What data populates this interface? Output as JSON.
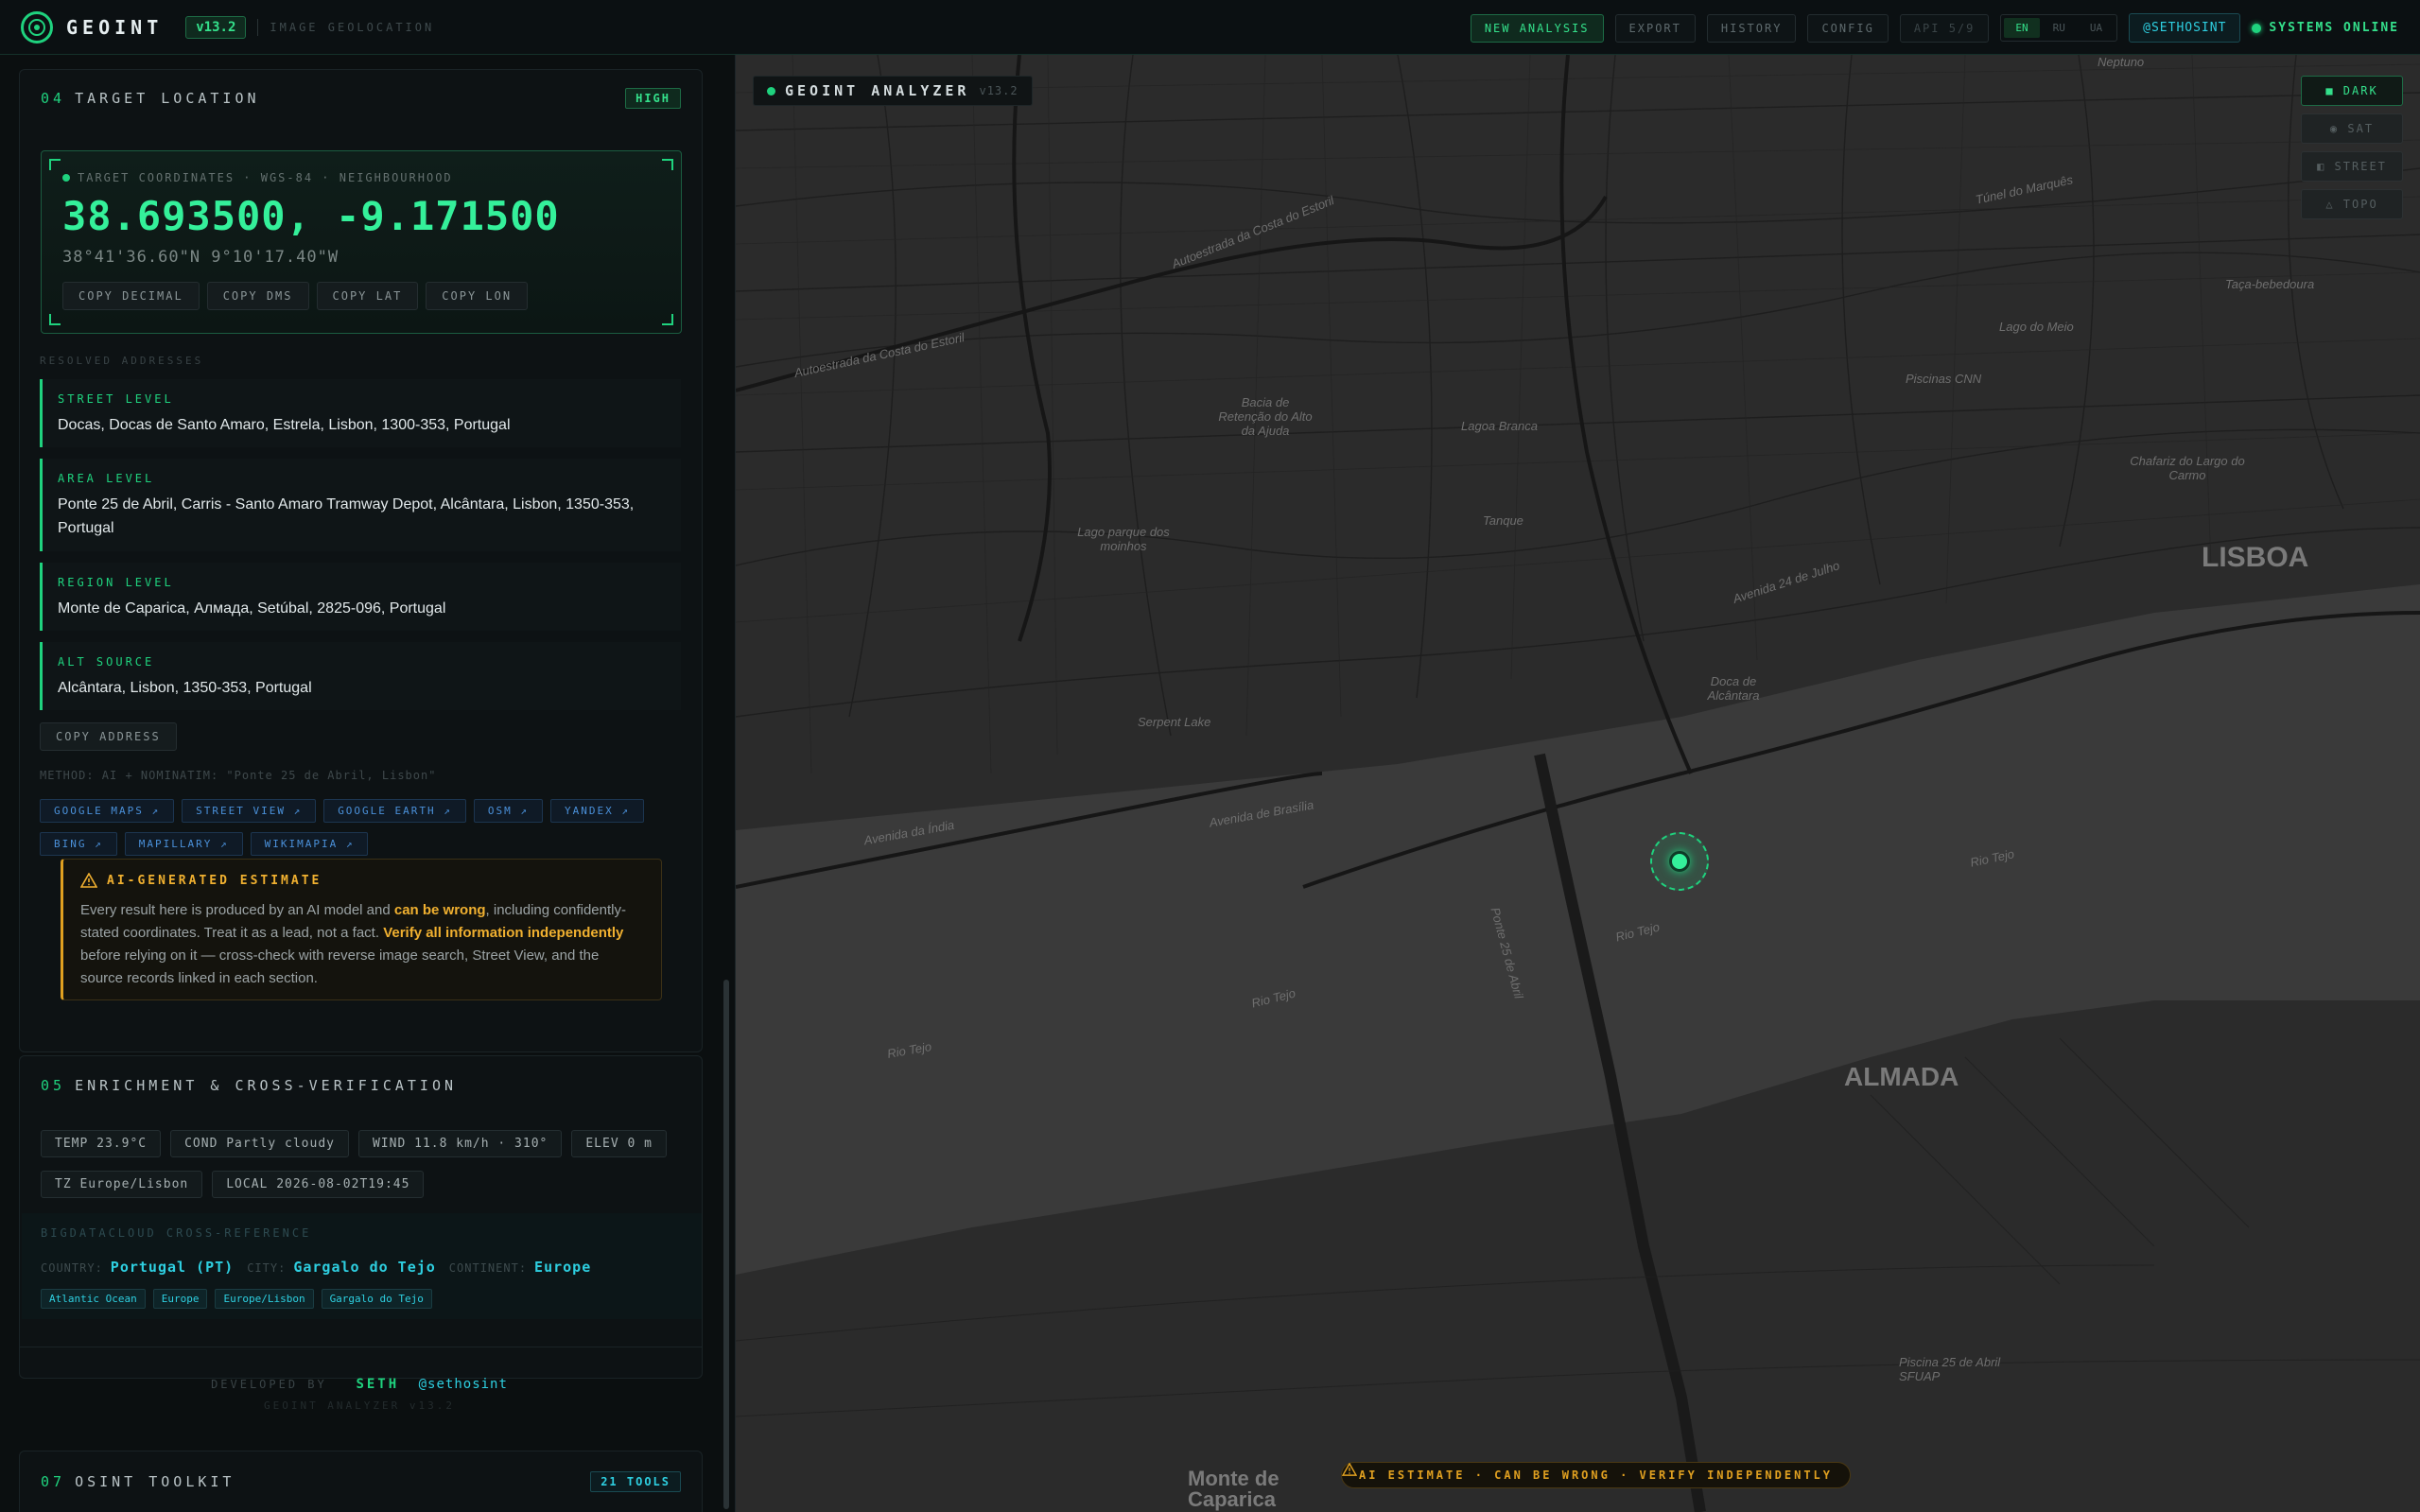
{
  "header": {
    "brand": "GEOINT",
    "version": "v13.2",
    "subtitle": "IMAGE GEOLOCATION",
    "buttons": [
      "NEW ANALYSIS",
      "EXPORT",
      "HISTORY",
      "CONFIG"
    ],
    "api": "API 5/9",
    "languages": [
      "EN",
      "RU",
      "UA"
    ],
    "handle": "@SETHOSINT",
    "status": "SYSTEMS ONLINE"
  },
  "target": {
    "num": "04",
    "title": "TARGET LOCATION",
    "confidence": "HIGH",
    "coord_label": "TARGET COORDINATES · WGS-84 · NEIGHBOURHOOD",
    "coord_decimal": "38.693500, -9.171500",
    "coord_dms": "38°41'36.60\"N 9°10'17.40\"W",
    "copy_buttons": [
      "COPY DECIMAL",
      "COPY DMS",
      "COPY LAT",
      "COPY LON"
    ],
    "resolved_label": "RESOLVED ADDRESSES",
    "addresses": [
      {
        "level": "STREET LEVEL",
        "text": "Docas, Docas de Santo Amaro, Estrela, Lisbon, 1300-353, Portugal"
      },
      {
        "level": "AREA LEVEL",
        "text": "Ponte 25 de Abril, Carris - Santo Amaro Tramway Depot, Alcântara, Lisbon, 1350-353, Portugal"
      },
      {
        "level": "REGION LEVEL",
        "text": "Monte de Caparica, Алмада, Setúbal, 2825-096, Portugal"
      },
      {
        "level": "ALT SOURCE",
        "text": "Alcântara, Lisbon, 1350-353, Portugal"
      }
    ],
    "copy_address": "COPY ADDRESS",
    "method": "METHOD: AI + NOMINATIM: \"Ponte 25 de Abril, Lisbon\"",
    "links": [
      "GOOGLE MAPS ↗",
      "STREET VIEW ↗",
      "GOOGLE EARTH ↗",
      "OSM ↗",
      "YANDEX ↗",
      "BING ↗",
      "MAPILLARY ↗",
      "WIKIMAPIA ↗"
    ],
    "warning": {
      "title": "AI-GENERATED ESTIMATE",
      "t1": "Every result here is produced by an AI model and ",
      "b1": "can be wrong",
      "t2": ", including confidently-stated coordinates. Treat it as a lead, not a fact. ",
      "b2": "Verify all information independently",
      "t3": " before relying on it — cross-check with reverse image search, Street View, and the source records linked in each section."
    }
  },
  "enrichment": {
    "num": "05",
    "title": "ENRICHMENT & CROSS-VERIFICATION",
    "chips_row1": [
      "TEMP 23.9°C",
      "COND Partly cloudy",
      "WIND 11.8 km/h · 310°",
      "ELEV 0 m"
    ],
    "chips_row2": [
      "TZ Europe/Lisbon",
      "LOCAL 2026-08-02T19:45"
    ],
    "bdc_label": "BIGDATACLOUD CROSS-REFERENCE",
    "country_key": "COUNTRY:",
    "country": "Portugal (PT)",
    "city_key": "CITY:",
    "city": "Gargalo do Tejo",
    "continent_key": "CONTINENT:",
    "continent": "Europe",
    "tags": [
      "Atlantic Ocean",
      "Europe",
      "Europe/Lisbon",
      "Gargalo do Tejo"
    ]
  },
  "footer": {
    "developed_by": "DEVELOPED BY",
    "dev_name": "SETH",
    "dev_handle": "@sethosint",
    "app_version": "GEOINT ANALYZER v13.2"
  },
  "toolkit": {
    "num": "07",
    "title": "OSINT TOOLKIT",
    "count": "21 TOOLS"
  },
  "map": {
    "title": "GEOINT ANALYZER",
    "version": "v13.2",
    "layers": [
      "DARK",
      "SAT",
      "STREET",
      "TOPO"
    ],
    "warning": "AI ESTIMATE · CAN BE WRONG · VERIFY INDEPENDENTLY",
    "labels": {
      "lisboa": "LISBOA",
      "almada": "ALMADA",
      "monte": "Monte de Caparica",
      "rio1": "Rio Tejo",
      "rio2": "Rio Tejo",
      "rio3": "Rio Tejo",
      "rio4": "Rio Tejo",
      "lagoa_branca": "Lagoa Branca",
      "tanque": "Tanque",
      "bacia": "Bacia de Retenção do Alto da Ajuda",
      "lago_parque": "Lago parque dos moinhos",
      "serpent": "Serpent Lake",
      "piscinas": "Piscinas CNN",
      "lago_meio": "Lago do Meio",
      "chafariz": "Chafariz do Largo do Carmo",
      "doca": "Doca de Alcântara",
      "av_india": "Avenida da Índia",
      "av_brasilia": "Avenida de Brasília",
      "av_24": "Avenida 24 de Julho",
      "autoestrada": "Autoestrada da Costa do Estoril",
      "ponte": "Ponte 25 de Abril",
      "tunel": "Túnel do Marquês",
      "taca": "Taça-bebedoura",
      "neptuno": "Neptuno",
      "piscina_abril": "Piscina 25 de Abril SFUAP"
    }
  }
}
